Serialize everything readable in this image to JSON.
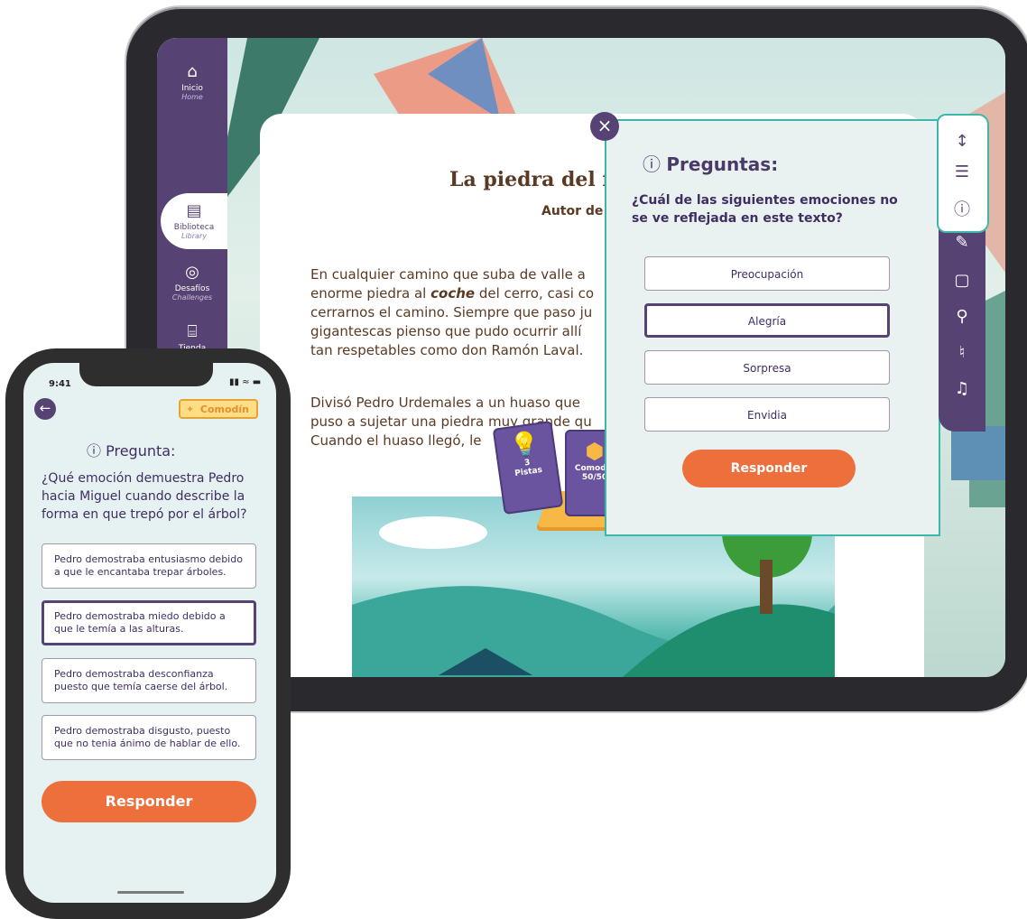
{
  "tablet": {
    "sidebar": [
      {
        "label": "Inicio",
        "sub": "Home",
        "icon": "home-icon"
      },
      {
        "label": "Biblioteca",
        "sub": "Library",
        "icon": "book-icon"
      },
      {
        "label": "Desafíos",
        "sub": "Challenges",
        "icon": "target-icon"
      },
      {
        "label": "Tienda",
        "sub": "",
        "icon": "store-icon"
      }
    ],
    "reader": {
      "title": "La piedra del fi",
      "author": "Autor de",
      "paragraph1": [
        "En cualquier camino que suba de valle a",
        "enorme piedra al",
        "coche",
        " del cerro, casi co",
        "cerrarnos el camino. Siempre que paso ju",
        "gigantescas pienso que pudo ocurrir allí",
        "tan respetables como don Ramón Laval."
      ],
      "paragraph2": [
        "Divisó Pedro Urdemales a un huaso que",
        "puso a sujetar una piedra muy grande qu",
        "Cuando el huaso llegó, le"
      ]
    },
    "questions": {
      "title": "Preguntas:",
      "question": "¿Cuál de las siguientes emociones no se ve reflejada en este texto?",
      "options": [
        "Preocupación",
        "Alegría",
        "Sorpresa",
        "Envidia"
      ],
      "selected_index": 1,
      "submit": "Responder"
    },
    "tools": [
      "text-size-icon",
      "settings-icon",
      "question-icon",
      "pencil-icon",
      "note-icon",
      "search-icon",
      "microphone-icon",
      "music-icon"
    ],
    "cards": [
      {
        "line1": "3",
        "line2": "Pistas"
      },
      {
        "line1": "Comodín",
        "line2": "50/50"
      }
    ]
  },
  "phone": {
    "time": "9:41",
    "comodin": "Comodín",
    "title": "Pregunta:",
    "question": "¿Qué emoción demuestra Pedro hacia Miguel cuando describe la forma en que trepó por el árbol?",
    "options": [
      "Pedro demostraba entusiasmo debido a que le encantaba trepar árboles.",
      "Pedro demostraba miedo debido a que le temía a las alturas.",
      "Pedro demostraba desconfianza puesto que temía caerse del árbol.",
      "Pedro demostraba disgusto, puesto que no tenia ánimo de hablar de ello."
    ],
    "selected_index": 1,
    "submit": "Responder"
  },
  "colors": {
    "primary": "#574274",
    "accent": "#ed6f3c",
    "teal": "#3fb7a8"
  }
}
